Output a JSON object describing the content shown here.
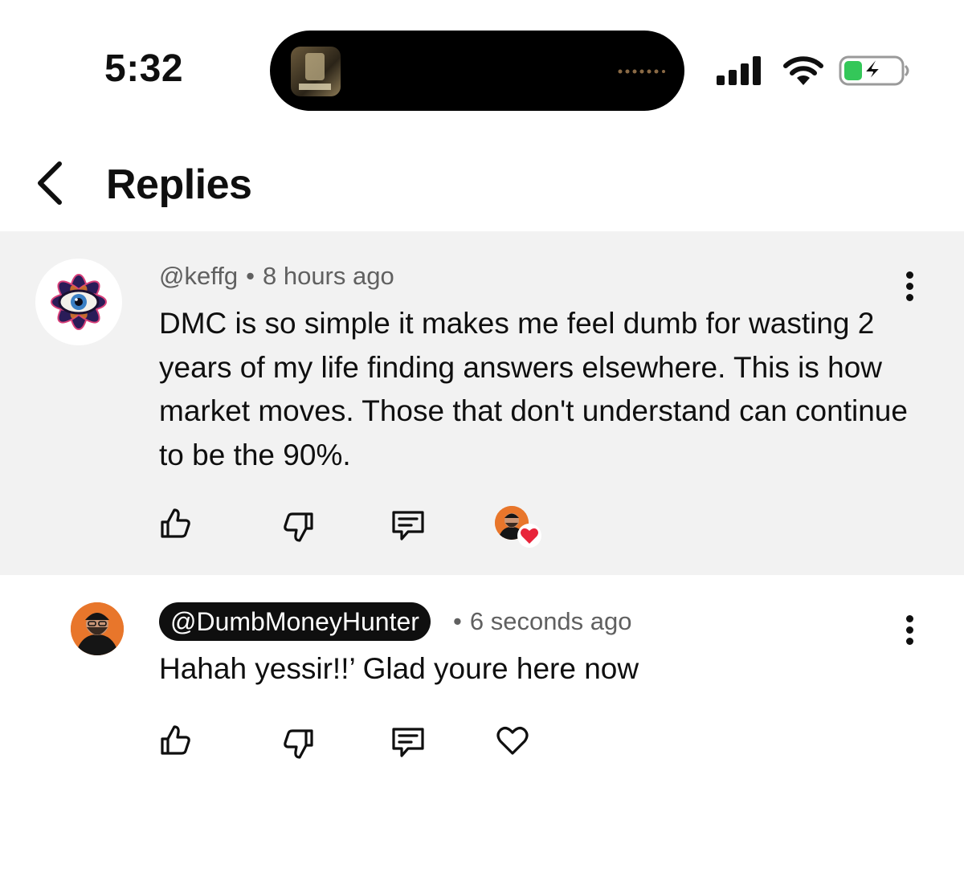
{
  "status_bar": {
    "time": "5:32"
  },
  "header": {
    "title": "Replies"
  },
  "comment": {
    "handle": "@keffg",
    "timestamp": "8 hours ago",
    "separator": "•",
    "text": "DMC is so simple it makes me feel dumb for wasting 2 years of my life finding answers elsewhere. This is how market moves. Those that don't understand can continue to be the 90%."
  },
  "reply": {
    "handle": "@DumbMoneyHunter",
    "timestamp": "6 seconds ago",
    "separator": "•",
    "text": "Hahah yessir!!’ Glad youre here now"
  },
  "icons": {
    "back": "chevron-left-icon",
    "like": "thumbs-up-icon",
    "dislike": "thumbs-down-icon",
    "reply": "comment-icon",
    "heart": "heart-icon",
    "more": "more-vertical-icon"
  },
  "colors": {
    "highlight_bg": "#f2f2f2",
    "meta_text": "#606060",
    "battery_green": "#34c759",
    "heart_red": "#e8243a",
    "creator_orange": "#e8762b"
  }
}
